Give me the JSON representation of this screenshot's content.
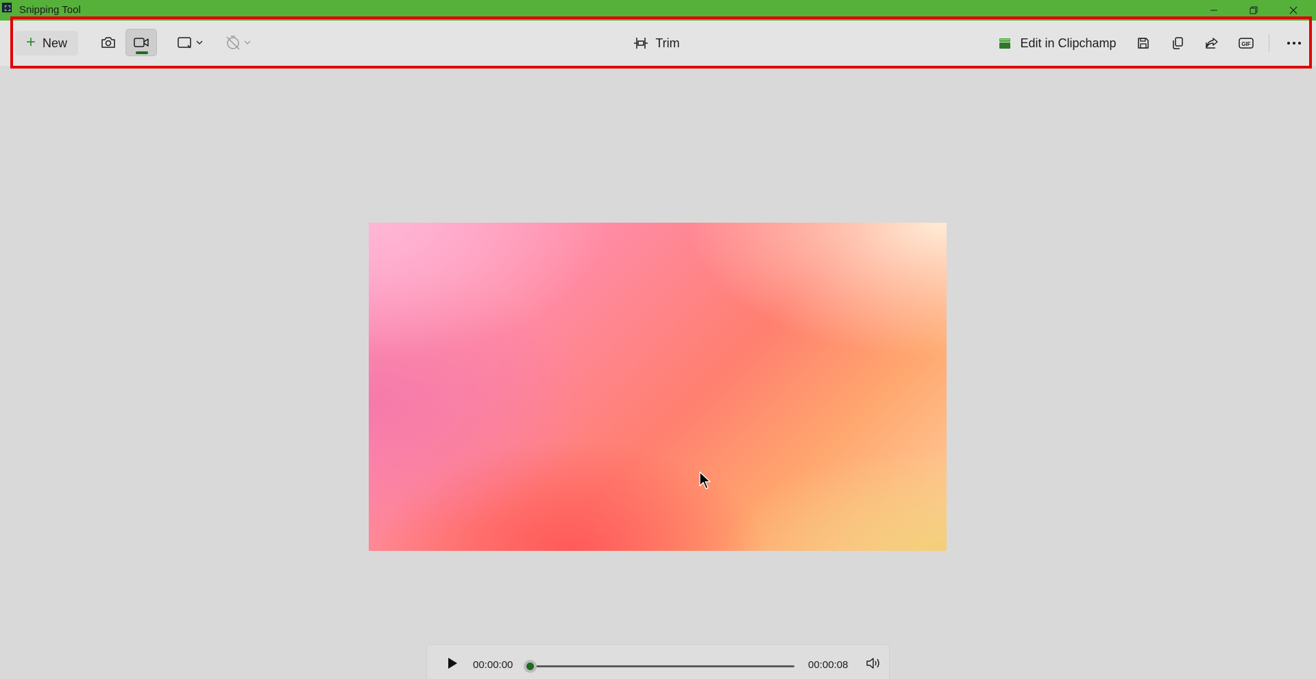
{
  "window": {
    "title": "Snipping Tool",
    "controls": [
      "minimize",
      "restore",
      "close"
    ]
  },
  "toolbar": {
    "new_label": "New",
    "modes": [
      {
        "icon": "camera-icon",
        "label": "Snip",
        "selected": false
      },
      {
        "icon": "video-camera-icon",
        "label": "Record",
        "selected": true
      }
    ],
    "shape_icon": "rectangle-mode-icon",
    "delay_icon": "no-delay-timer-icon",
    "trim_label": "Trim",
    "clipchamp_label": "Edit in Clipchamp",
    "actions": [
      "save-icon",
      "copy-icon",
      "share-icon",
      "gif-icon",
      "more-icon"
    ]
  },
  "player": {
    "current_time": "00:00:00",
    "total_time": "00:00:08",
    "progress": 0
  },
  "colors": {
    "titlebar": "#55b13a",
    "accent_green": "#1d6b1f",
    "highlight_border": "#e00000",
    "background": "#d9d9d9"
  }
}
